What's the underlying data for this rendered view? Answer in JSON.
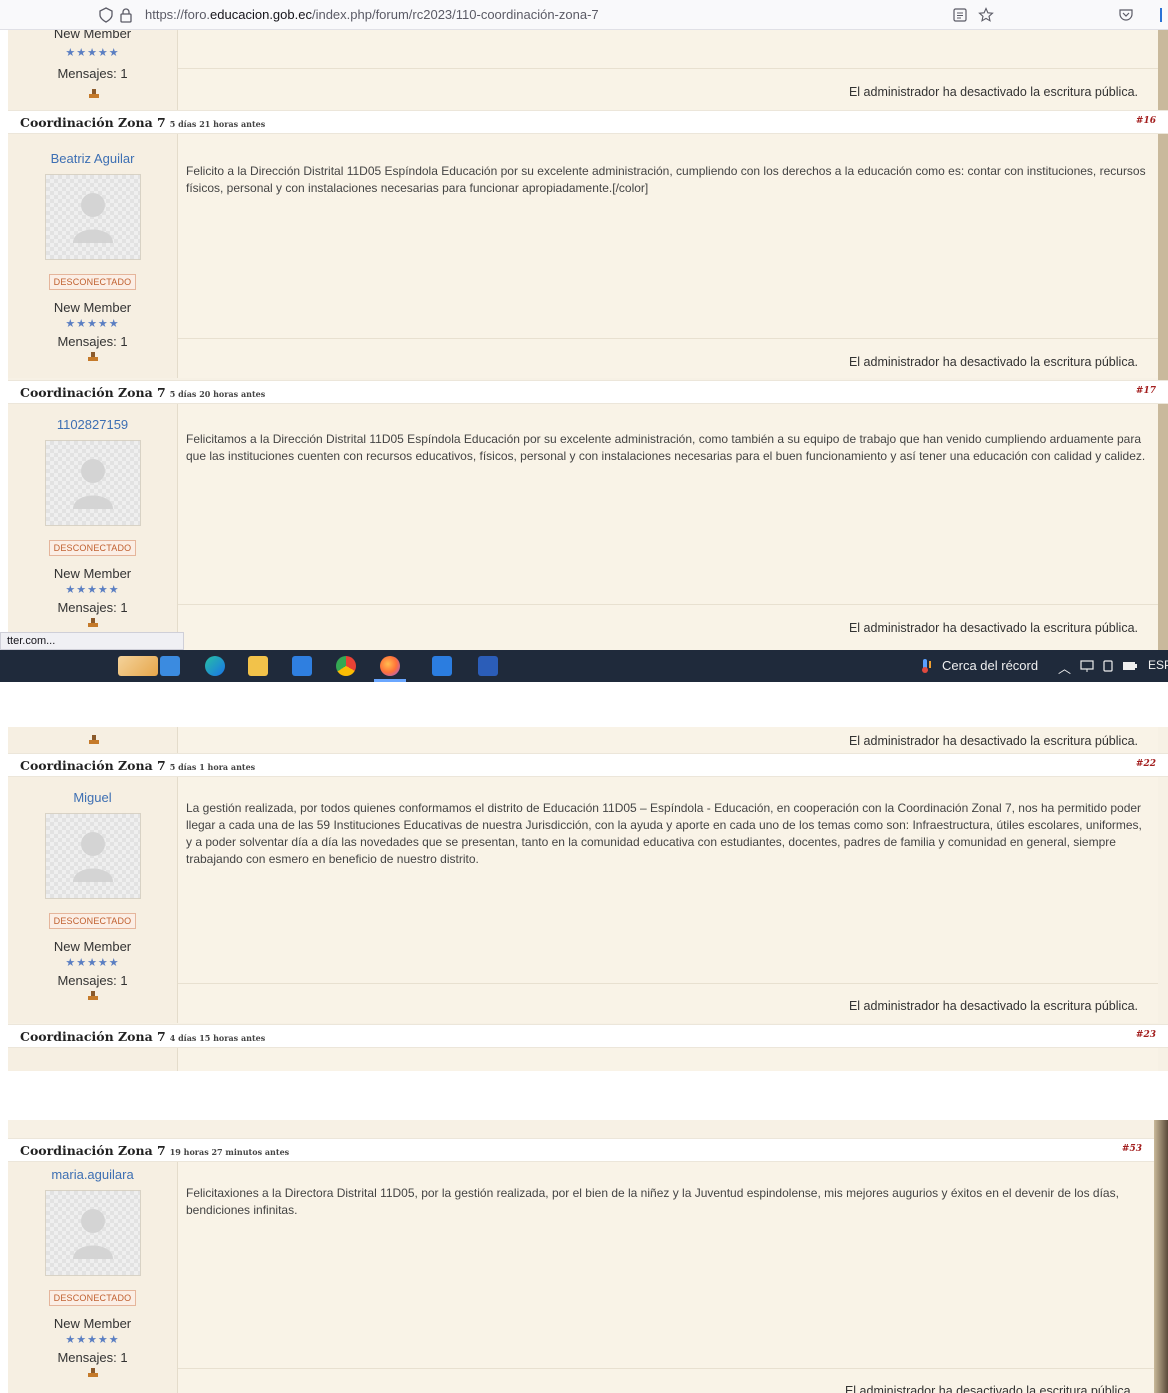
{
  "browser": {
    "url_prefix": "https://foro.",
    "url_host": "educacion.gob.ec",
    "url_path": "/index.php/forum/rc2023/110-coordinación-zona-7"
  },
  "common": {
    "status_badge": "DESCONECTADO",
    "rank": "New Member",
    "stars": "★★★★★",
    "messages": "Mensajes: 1",
    "write_disabled": "El administrador ha desactivado la escritura pública.",
    "header_author": "Coordinación Zona 7"
  },
  "shot1": {
    "top_rank": "New Member",
    "posts": [
      {
        "when": "5 días 21 horas antes",
        "num": "#16",
        "user": "Beatriz Aguilar",
        "text": "Felicito a la Dirección Distrital 11D05 Espíndola Educación por su excelente administración, cumpliendo con los derechos a la educación como es: contar con instituciones, recursos físicos, personal y con instalaciones necesarias para funcionar apropiadamente.[/color]"
      },
      {
        "when": "5 días 20 horas antes",
        "num": "#17",
        "user": "1102827159",
        "text": "Felicitamos a la Dirección Distrital 11D05 Espíndola Educación por su excelente administración, como también a su equipo de trabajo que han venido cumpliendo arduamente para que las instituciones cuenten con recursos educativos, físicos, personal y con instalaciones necesarias para el buen funcionamiento y así tener una educación con calidad y calidez."
      }
    ],
    "status_link": "tter.com...",
    "taskbar": {
      "weather": "Cerca del récord",
      "lang": "ESP"
    }
  },
  "shot2": {
    "posts": [
      {
        "when": "5 días 1 hora antes",
        "num": "#22",
        "user": "Miguel",
        "text": "La gestión realizada, por todos quienes conformamos el distrito de Educación 11D05 – Espíndola - Educación, en cooperación con la Coordinación Zonal 7, nos ha permitido poder llegar a cada una de las 59 Instituciones Educativas de nuestra Jurisdicción, con la ayuda y aporte en cada uno de los temas como son: Infraestructura, útiles escolares, uniformes, y a poder solventar día a día las novedades que se presentan, tanto en la comunidad educativa con estudiantes, docentes, padres de familia y comunidad en general, siempre trabajando con esmero en beneficio de nuestro distrito."
      },
      {
        "when": "4 días 15 horas antes",
        "num": "#23"
      }
    ]
  },
  "shot3": {
    "posts": [
      {
        "when": "19 horas 27 minutos antes",
        "num": "#53",
        "user": "maria.aguilara",
        "text": "Felicitaxiones a la Directora Distrital 11D05, por la gestión realizada, por el bien de la niñez y la Juventud espindolense, mis mejores augurios y éxitos en el devenir de los días, bendiciones infinitas."
      }
    ]
  }
}
